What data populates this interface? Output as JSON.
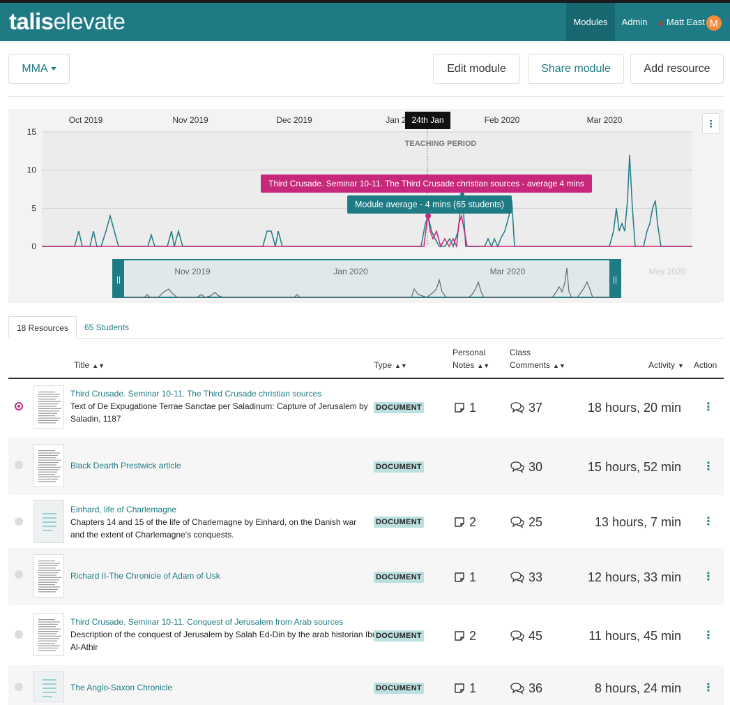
{
  "brand": {
    "name_bold": "talis",
    "name_light": "elevate"
  },
  "nav": {
    "modules": "Modules",
    "admin": "Admin",
    "user": "Matt East",
    "avatar_letter": "M"
  },
  "toolbar": {
    "module_select": "MMA",
    "edit": "Edit module",
    "share": "Share module",
    "add": "Add resource"
  },
  "chart_data": {
    "type": "line",
    "x_axis": [
      "Oct 2019",
      "Nov 2019",
      "Dec 2019",
      "Jan 2020",
      "Feb 2020",
      "Mar 2020"
    ],
    "y_ticks": [
      0,
      5,
      10,
      15
    ],
    "ylim": [
      0,
      15
    ],
    "annotation_date": "24th Jan",
    "annotation_label": "TEACHING PERIOD",
    "tooltip_resource": "Third Crusade. Seminar 10-11. The Third Crusade christian sources - average 4 mins",
    "tooltip_module": "Module average - 4 mins (65 students)",
    "series": [
      {
        "name": "Module average",
        "color": "#1e7b84"
      },
      {
        "name": "Third Crusade. Seminar 10-11. The Third Crusade christian sources",
        "color": "#c8287c"
      }
    ],
    "navigator_axis": [
      "Nov 2019",
      "Jan 2020",
      "Mar 2020",
      "May 2020"
    ]
  },
  "tabs": {
    "resources": "18 Resources",
    "students": "65 Students"
  },
  "table": {
    "headers": {
      "title": "Title",
      "type": "Type",
      "notes_1": "Personal",
      "notes_2": "Notes",
      "comments_1": "Class",
      "comments_2": "Comments",
      "activity": "Activity",
      "action": "Action"
    },
    "rows": [
      {
        "title": "Third Crusade. Seminar 10-11. The Third Crusade christian sources",
        "desc": "Text of De Expugatione Terrae Sanctae per Saladinum: Capture of Jerusalem by Saladin, 1187",
        "type": "DOCUMENT",
        "notes": "1",
        "comments": "37",
        "activity": "18 hours, 20 min"
      },
      {
        "title": "Black Dearth Prestwick article",
        "desc": "",
        "type": "DOCUMENT",
        "notes": "",
        "comments": "30",
        "activity": "15 hours, 52 min"
      },
      {
        "title": "Einhard, life of Charlemagne",
        "desc": "Chapters 14 and 15 of the life of Charlemagne by Einhard, on the Danish war and the extent of Charlemagne's conquests.",
        "type": "DOCUMENT",
        "notes": "2",
        "comments": "25",
        "activity": "13 hours, 7 min"
      },
      {
        "title": "Richard II-The Chronicle of Adam of Usk",
        "desc": "",
        "type": "DOCUMENT",
        "notes": "1",
        "comments": "33",
        "activity": "12 hours, 33 min"
      },
      {
        "title": "Third Crusade. Seminar 10-11. Conquest of Jerusalem from Arab sources",
        "desc": "Description of the conquest of Jerusalem by Salah Ed-Din by the arab historian Ibn Al-Athir",
        "type": "DOCUMENT",
        "notes": "2",
        "comments": "45",
        "activity": "11 hours, 45 min"
      },
      {
        "title": "The Anglo-Saxon Chronicle",
        "desc": "",
        "type": "DOCUMENT",
        "notes": "1",
        "comments": "36",
        "activity": "8 hours, 24 min"
      }
    ]
  }
}
